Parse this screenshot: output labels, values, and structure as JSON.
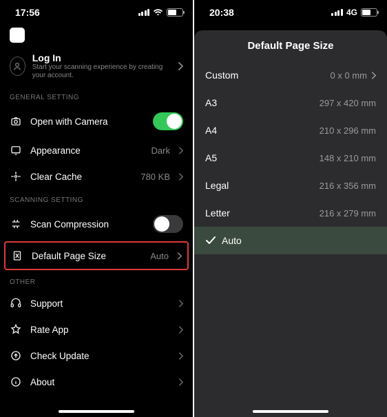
{
  "left": {
    "status": {
      "time": "17:56"
    },
    "login": {
      "title": "Log In",
      "subtitle": "Start your scanning experience by creating your account."
    },
    "sections": {
      "general": "GENERAL SETTING",
      "scanning": "SCANNING SETTING",
      "other": "OTHER"
    },
    "rows": {
      "open_camera": "Open with Camera",
      "appearance": "Appearance",
      "appearance_val": "Dark",
      "clear_cache": "Clear Cache",
      "clear_cache_val": "780 KB",
      "scan_compression": "Scan Compression",
      "default_page_size": "Default Page Size",
      "default_page_size_val": "Auto",
      "support": "Support",
      "rate": "Rate App",
      "update": "Check Update",
      "about": "About"
    }
  },
  "right": {
    "status": {
      "time": "20:38",
      "network": "4G"
    },
    "title": "Default Page Size",
    "options": [
      {
        "label": "Custom",
        "value": "0 x 0 mm",
        "chevron": true
      },
      {
        "label": "A3",
        "value": "297 x 420 mm"
      },
      {
        "label": "A4",
        "value": "210 x 296 mm"
      },
      {
        "label": "A5",
        "value": "148 x 210 mm"
      },
      {
        "label": "Legal",
        "value": "216 x 356 mm"
      },
      {
        "label": "Letter",
        "value": "216 x 279 mm"
      },
      {
        "label": "Auto",
        "selected": true
      }
    ]
  }
}
